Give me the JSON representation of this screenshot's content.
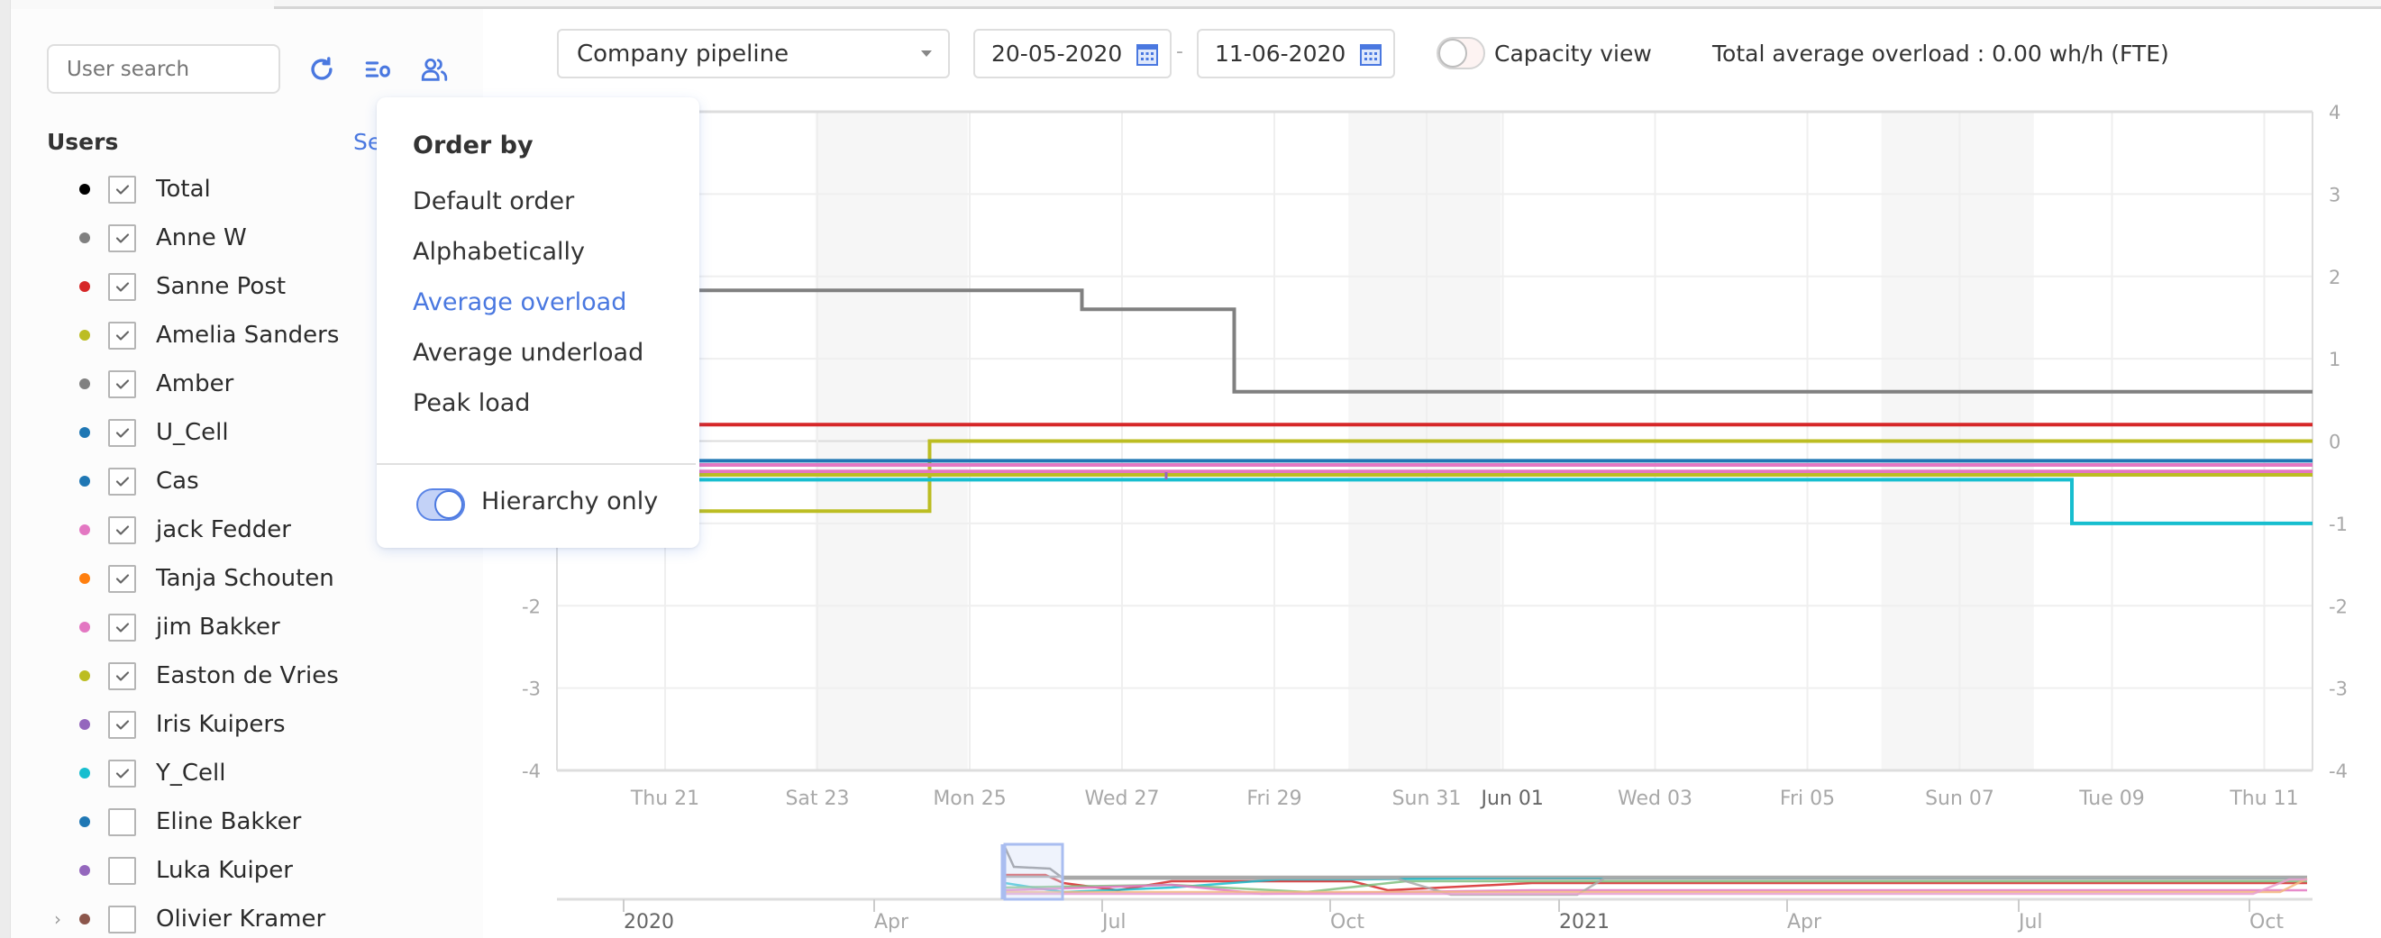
{
  "toolbar": {
    "search_placeholder": "User search",
    "refresh_icon": "refresh-icon",
    "order_icon": "sort-order-icon",
    "group_icon": "users-group-icon"
  },
  "users": {
    "title": "Users",
    "select_link": "Se",
    "items": [
      {
        "name": "Total",
        "color": "#000000",
        "checked": true
      },
      {
        "name": "Anne W",
        "color": "#808080",
        "checked": true
      },
      {
        "name": "Sanne Post",
        "color": "#d62728",
        "checked": true
      },
      {
        "name": "Amelia Sanders",
        "color": "#bcbd22",
        "checked": true
      },
      {
        "name": "Amber",
        "color": "#808080",
        "checked": true
      },
      {
        "name": "U_Cell",
        "color": "#1f77b4",
        "checked": true
      },
      {
        "name": "Cas",
        "color": "#1f77b4",
        "checked": true
      },
      {
        "name": "jack Fedder",
        "color": "#e377c2",
        "checked": true
      },
      {
        "name": "Tanja Schouten",
        "color": "#ff7f0e",
        "checked": true
      },
      {
        "name": "jim Bakker",
        "color": "#e377c2",
        "checked": true
      },
      {
        "name": "Easton de Vries",
        "color": "#bcbd22",
        "checked": true
      },
      {
        "name": "Iris Kuipers",
        "color": "#9467bd",
        "checked": true
      },
      {
        "name": "Y_Cell",
        "color": "#17becf",
        "checked": true
      },
      {
        "name": "Eline Bakker",
        "color": "#1f77b4",
        "checked": false
      },
      {
        "name": "Luka Kuiper",
        "color": "#9467bd",
        "checked": false
      },
      {
        "name": "Olivier Kramer",
        "color": "#8c564b",
        "checked": false,
        "expandable": true
      }
    ]
  },
  "filters": {
    "pipeline": "Company pipeline",
    "date_from": "20-05-2020",
    "date_separator": "-",
    "date_to": "11-06-2020",
    "capacity_view_label": "Capacity view",
    "capacity_view_on": false,
    "total_average_overload": "Total average overload : 0.00 wh/h (FTE)"
  },
  "order_menu": {
    "title": "Order by",
    "options": [
      "Default order",
      "Alphabetically",
      "Average overload",
      "Average underload",
      "Peak load"
    ],
    "selected": "Average overload",
    "hierarchy_only_label": "Hierarchy only",
    "hierarchy_only_on": true
  },
  "accent_color": "#4a78e0",
  "chart_data": {
    "type": "line",
    "step": true,
    "title": "",
    "xlabel": "",
    "ylabel": "",
    "ylim": [
      -4,
      4
    ],
    "yticks": [
      4,
      3,
      2,
      1,
      0,
      -1,
      -2,
      -3,
      -4
    ],
    "x_domain_days": [
      "2020-05-20",
      "2020-06-11"
    ],
    "xticks": [
      {
        "label": "Thu 21",
        "date": "2020-05-21"
      },
      {
        "label": "Sat 23",
        "date": "2020-05-23"
      },
      {
        "label": "Mon 25",
        "date": "2020-05-25"
      },
      {
        "label": "Wed 27",
        "date": "2020-05-27"
      },
      {
        "label": "Fri 29",
        "date": "2020-05-29"
      },
      {
        "label": "Sun 31",
        "date": "2020-05-31"
      },
      {
        "label": "Jun 01",
        "date": "2020-06-01",
        "major": true
      },
      {
        "label": "Wed 03",
        "date": "2020-06-03"
      },
      {
        "label": "Fri 05",
        "date": "2020-06-05"
      },
      {
        "label": "Sun 07",
        "date": "2020-06-07"
      },
      {
        "label": "Tue 09",
        "date": "2020-06-09"
      },
      {
        "label": "Thu 11",
        "date": "2020-06-11"
      }
    ],
    "weekends": [
      [
        "2020-05-23",
        "2020-05-25"
      ],
      [
        "2020-05-30",
        "2020-06-01"
      ],
      [
        "2020-06-06",
        "2020-06-08"
      ]
    ],
    "series": [
      {
        "name": "Anne W",
        "color": "#808080",
        "points": [
          [
            0,
            1.83
          ],
          [
            6.5,
            1.83
          ],
          [
            6.5,
            1.6
          ],
          [
            8.5,
            1.6
          ],
          [
            8.5,
            0.6
          ],
          [
            22.5,
            0.6
          ]
        ]
      },
      {
        "name": "Sanne Post",
        "color": "#d62728",
        "points": [
          [
            0,
            0.2
          ],
          [
            22.5,
            0.2
          ]
        ]
      },
      {
        "name": "Amelia Sanders",
        "color": "#bcbd22",
        "points": [
          [
            0,
            -0.85
          ],
          [
            4.5,
            -0.85
          ],
          [
            4.5,
            0.0
          ],
          [
            22.5,
            0.0
          ]
        ]
      },
      {
        "name": "U_Cell",
        "color": "#1f77b4",
        "points": [
          [
            0,
            -0.24
          ],
          [
            22.5,
            -0.24
          ]
        ]
      },
      {
        "name": "jack Fedder",
        "color": "#e377c2",
        "points": [
          [
            0,
            -0.29
          ],
          [
            22.5,
            -0.29
          ]
        ]
      },
      {
        "name": "jim Bakker",
        "color": "#e377c2",
        "points": [
          [
            0,
            -0.37
          ],
          [
            22.5,
            -0.37
          ]
        ]
      },
      {
        "name": "Easton de Vries",
        "color": "#bcbd22",
        "points": [
          [
            0,
            -0.41
          ],
          [
            22.5,
            -0.41
          ]
        ]
      },
      {
        "name": "Y_Cell",
        "color": "#17becf",
        "points": [
          [
            0,
            -0.47
          ],
          [
            19.5,
            -0.47
          ],
          [
            19.5,
            -1.0
          ],
          [
            22.5,
            -1.0
          ]
        ]
      }
    ],
    "navigator": {
      "xticks": [
        {
          "label": "2020",
          "major": true
        },
        {
          "label": "Apr"
        },
        {
          "label": "Jul"
        },
        {
          "label": "Oct"
        },
        {
          "label": "2021",
          "major": true
        },
        {
          "label": "Apr"
        },
        {
          "label": "Jul"
        },
        {
          "label": "Oct"
        }
      ]
    }
  }
}
